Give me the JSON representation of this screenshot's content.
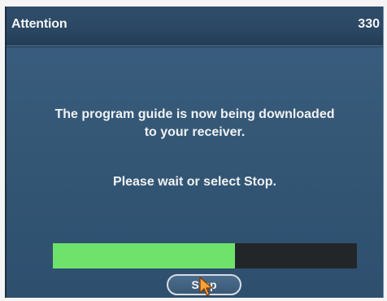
{
  "dialog": {
    "title": "Attention",
    "code": "330",
    "message_lines": [
      "The program guide is now being downloaded",
      "to your receiver."
    ],
    "prompt": "Please wait or select Stop."
  },
  "progress": {
    "fraction": 0.6,
    "fill_color": "#6fe26c",
    "track_color": "#222628"
  },
  "buttons": {
    "stop_label": "Stop"
  },
  "icons": {
    "cursor": "mouse-pointer-icon"
  }
}
